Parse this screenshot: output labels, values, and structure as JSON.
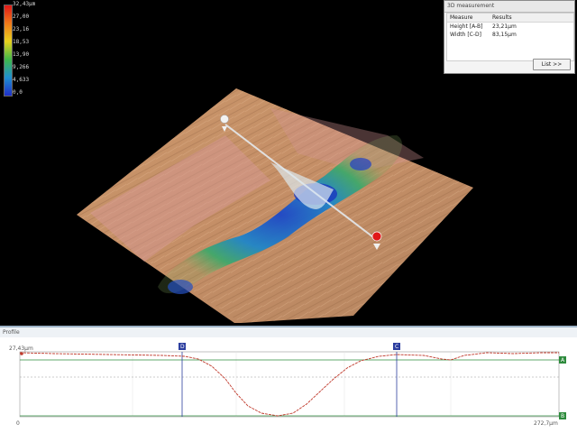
{
  "colorbar": {
    "unit_max": "32,43µm",
    "labels": [
      "27,00",
      "23,16",
      "18,53",
      "13,90",
      "9,266",
      "4,633",
      "0,0"
    ],
    "colors": [
      "#e01818",
      "#f07a1a",
      "#e8d21e",
      "#3fb84a",
      "#1f8fd0",
      "#1f2fc8"
    ]
  },
  "measurement": {
    "title": "3D measurement",
    "col_measure": "Measure",
    "col_results": "Results",
    "rows": [
      {
        "measure": "Height [A-B]",
        "result": "23,21µm"
      },
      {
        "measure": "Width [C-D]",
        "result": "83,15µm"
      }
    ],
    "list_button": "List >>"
  },
  "profile": {
    "title": "Profile",
    "y_top_label": "27,43µm",
    "x_start_label": "0",
    "x_end_label": "272,7µm",
    "marker_d": "D",
    "marker_c": "C",
    "marker_a": "A",
    "marker_b": "B",
    "profile_color": "#c0392b",
    "line_a_color": "#2e8b3d",
    "cursor_color": "#2c3e9f"
  }
}
